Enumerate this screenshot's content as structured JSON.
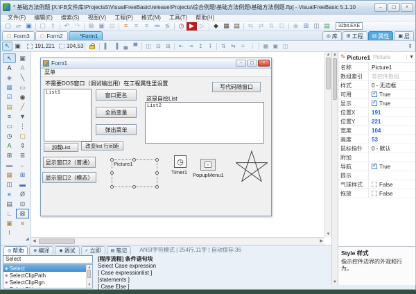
{
  "window": {
    "title": "* 基础方法例题 [X:\\FB文件库\\Projects5\\VisualFreeBasic\\release\\Projects\\综合例题\\基础方法例题\\基础方法例题.ffp] - VisualFreeBasic 5.1.10",
    "minimize": "–",
    "maximize": "▢",
    "close": "×"
  },
  "menu_bar": {
    "items": [
      "文件(F)",
      "编辑(E)",
      "搜索(S)",
      "视图(V)",
      "工程(P)",
      "格式(M)",
      "工具(T)",
      "帮助(H)"
    ]
  },
  "toolbar_main": {
    "build_target": "32bit.EXE",
    "icons": [
      {
        "n": "new-file-icon",
        "g": "▢",
        "c": "#4a7fc4"
      },
      {
        "n": "open-folder-icon",
        "g": "▱",
        "c": "#4a7fc4"
      },
      {
        "n": "save-icon",
        "g": "▣",
        "c": "#4a7fc4"
      },
      {
        "n": "sep",
        "sep": true
      },
      {
        "n": "save-as-icon",
        "g": "▢",
        "c": "#9aa8b8"
      },
      {
        "n": "import-icon",
        "g": "⇪",
        "c": "#9aa8b8"
      },
      {
        "n": "sep",
        "sep": true
      },
      {
        "n": "undo-icon",
        "g": "↶",
        "c": "#7a92b0"
      },
      {
        "n": "redo-icon",
        "g": "↷",
        "c": "#b8c4d0"
      },
      {
        "n": "sep",
        "sep": true
      },
      {
        "n": "delete-code-icon",
        "g": "⊠",
        "c": "#8aa0c0"
      },
      {
        "n": "copy-code-icon",
        "g": "▣",
        "c": "#8aa0c0"
      },
      {
        "n": "paste-code-icon",
        "g": "▤",
        "c": "#c0c8d4"
      },
      {
        "n": "sep",
        "sep": true
      },
      {
        "n": "align-icon",
        "g": "≡",
        "c": "#d08030"
      },
      {
        "n": "indent-icon",
        "g": "≡",
        "c": "#90a4bc"
      },
      {
        "n": "outdent-icon",
        "g": "≡",
        "c": "#90a4bc"
      },
      {
        "n": "bullets-icon",
        "g": "≔",
        "c": "#5080c0"
      },
      {
        "n": "sort-icon",
        "g": "≶",
        "c": "#90a4bc"
      },
      {
        "n": "sep",
        "sep": true
      },
      {
        "n": "compile-icon",
        "g": "◷",
        "c": "#c23030"
      },
      {
        "n": "run-icon",
        "g": "▶",
        "c": "#ffffff",
        "bg": "#b82020"
      },
      {
        "n": "run-alt-icon",
        "g": "▷",
        "c": "#9aa8b8"
      },
      {
        "n": "sep",
        "sep": true
      },
      {
        "n": "build-exe-icon",
        "g": "◆",
        "c": "#46392c"
      },
      {
        "n": "build-image-icon",
        "g": "▦",
        "c": "#54483c"
      },
      {
        "n": "build-media-icon",
        "g": "▤",
        "c": "#54483c"
      },
      {
        "n": "sep",
        "sep": true
      },
      {
        "n": "debug-jump-icon",
        "g": "⇆",
        "c": "#b4bfca"
      },
      {
        "n": "debug-step-icon",
        "g": "⇄",
        "c": "#b4bfca"
      },
      {
        "n": "debug-over-icon",
        "g": "⇅",
        "c": "#b4bfca"
      },
      {
        "n": "breakpoint-icon",
        "g": "⊡",
        "c": "#b4bfca"
      },
      {
        "n": "sep",
        "sep": true
      },
      {
        "n": "stamp-icon",
        "g": "◉",
        "c": "#b4bfca"
      },
      {
        "n": "grid-window-icon",
        "g": "⊞",
        "c": "#4a7fc4"
      },
      {
        "n": "window-icon",
        "g": "◫",
        "c": "#6a7a8a"
      },
      {
        "n": "notes-icon",
        "g": "▤",
        "c": "#3a9a5a"
      }
    ]
  },
  "form_tabs": [
    {
      "label": "Form3",
      "active": false
    },
    {
      "label": "Form2",
      "active": false
    },
    {
      "label": "*Form1",
      "active": true
    }
  ],
  "panel_tabs": [
    {
      "label": "库",
      "ic": "◎",
      "active": false
    },
    {
      "label": "工程",
      "ic": "⊞",
      "active": false
    },
    {
      "label": "属性",
      "ic": "▤",
      "active": true
    },
    {
      "label": "层",
      "ic": "▣",
      "active": false
    }
  ],
  "designer_toolbar": {
    "position": "191,221",
    "size": "104,53",
    "spinner": "⇕",
    "icons": [
      {
        "n": "align-left-icon",
        "g": "▌"
      },
      {
        "n": "align-right-icon",
        "g": "▐"
      },
      {
        "n": "align-bottom-icon",
        "g": "▄"
      },
      {
        "n": "align-top-icon",
        "g": "▀"
      },
      {
        "n": "sep",
        "sep": true
      },
      {
        "n": "center-h-icon",
        "g": "◫"
      },
      {
        "n": "center-v-icon",
        "g": "⊟"
      },
      {
        "n": "center-both-icon",
        "g": "⊞"
      },
      {
        "n": "sep",
        "sep": true
      },
      {
        "n": "space-left-icon",
        "g": "⇤"
      },
      {
        "n": "space-right-icon",
        "g": "⇥"
      },
      {
        "n": "space-up-icon",
        "g": "↥"
      },
      {
        "n": "space-down-icon",
        "g": "↧"
      },
      {
        "n": "sep",
        "sep": true
      },
      {
        "n": "same-height-icon",
        "g": "⇅"
      },
      {
        "n": "same-width-icon",
        "g": "⇆"
      },
      {
        "n": "same-size-icon",
        "g": "≡"
      },
      {
        "n": "distribute-icon",
        "g": "⋮"
      },
      {
        "n": "sep",
        "sep": true
      },
      {
        "n": "to-grid-icon",
        "g": "▦"
      },
      {
        "n": "to-front-icon",
        "g": "▣"
      },
      {
        "n": "to-back-icon",
        "g": "◫"
      }
    ]
  },
  "toolbox": {
    "tools": [
      {
        "n": "pointer-tool",
        "g": "↖",
        "c": "#2a4a6a",
        "sel": true
      },
      {
        "n": "select-group-tool",
        "g": "▣",
        "c": "#5a6a7a"
      },
      {
        "n": "label-tool",
        "g": "A",
        "c": "#222222"
      },
      {
        "n": "link-label-tool",
        "g": "A",
        "c": "#8a9ab0"
      },
      {
        "n": "shape-tool",
        "g": "◈",
        "c": "#7a6ab0"
      },
      {
        "n": "line-tool",
        "g": "╲",
        "c": "#555555"
      },
      {
        "n": "image-tool",
        "g": "▦",
        "c": "#5a8ac0"
      },
      {
        "n": "frame-tool",
        "g": "▭",
        "c": "#777777"
      },
      {
        "n": "checkbox-tool",
        "g": "☑",
        "c": "#3a7ac0"
      },
      {
        "n": "radio-tool",
        "g": "◉",
        "c": "#444444"
      },
      {
        "n": "tab-page-tool",
        "g": "▤",
        "c": "#b08a40"
      },
      {
        "n": "pen-tool",
        "g": "╱",
        "c": "#b06a30"
      },
      {
        "n": "listbox-tool",
        "g": "≡",
        "c": "#505a64"
      },
      {
        "n": "combobox-tool",
        "g": "▼",
        "c": "#505a64"
      },
      {
        "n": "textbox-tool",
        "g": "▭",
        "c": "#3a6ac0"
      },
      {
        "n": "slider-tool",
        "g": "⋮",
        "c": "#505a64"
      },
      {
        "n": "timer-tool",
        "g": "◷",
        "c": "#444444"
      },
      {
        "n": "folder-tool",
        "g": "▢",
        "c": "#b09040"
      },
      {
        "n": "auto-label-tool",
        "g": "A",
        "c": "#2a7a3a"
      },
      {
        "n": "updown-tool",
        "g": "⇕",
        "c": "#44505c"
      },
      {
        "n": "grid-tool",
        "g": "⊞",
        "c": "#505a64"
      },
      {
        "n": "tree-tool",
        "g": "≣",
        "c": "#505a64"
      },
      {
        "n": "separator-tool",
        "g": "▬",
        "c": "#9099a8"
      },
      {
        "n": "arrow-tool",
        "g": "←",
        "c": "#505a64"
      },
      {
        "n": "picturebox-tool",
        "g": "▦",
        "c": "#b08a40"
      },
      {
        "n": "calendar-tool",
        "g": "⊞",
        "c": "#3a6ac0"
      },
      {
        "n": "tabstrip-tool",
        "g": "◫",
        "c": "#505a64"
      },
      {
        "n": "statusbar-tool",
        "g": "▬",
        "c": "#3a6ac0"
      },
      {
        "n": "browser-tool",
        "g": "e",
        "c": "#2a7ad0"
      },
      {
        "n": "orbit-tool",
        "g": "Ø",
        "c": "#505a64"
      },
      {
        "n": "listview-tool",
        "g": "▤",
        "c": "#505a64"
      },
      {
        "n": "optionbox-tool",
        "g": "⊡",
        "c": "#505a64"
      },
      {
        "n": "chart-tool",
        "g": "∟",
        "c": "#505a64"
      },
      {
        "n": "close-box-tool",
        "g": "⊠",
        "c": "#44505c",
        "picked": true
      },
      {
        "n": "image-frame-tool",
        "g": "▣",
        "c": "#b08a40"
      },
      {
        "n": "database-tool",
        "g": "≡",
        "c": "#a08030"
      },
      {
        "n": "warning-tool",
        "g": "!",
        "c": "#c04040"
      },
      {
        "n": "blank-tool",
        "g": "",
        "c": "#000000"
      }
    ]
  },
  "designer": {
    "form": {
      "title": "Form1",
      "minimize": "–",
      "maximize": "▢",
      "close": "×",
      "menu": "菜单",
      "info_label": "不需要DOS窗口（调试输出用）在工程属性里设置",
      "code_button": "写代码随窗口",
      "list1_text": "List1",
      "mid_buttons": [
        {
          "label": "窗口更名"
        },
        {
          "label": "全局变量"
        },
        {
          "label": "弹出菜单"
        }
      ],
      "list2_label": "这是自绘List",
      "list2_text": "List2",
      "load_button": "加载List",
      "spacing_button": "改变list 行间距",
      "show_normal_button": "显示窗口2（普通）",
      "show_modal_button": "显示窗口2（模态）",
      "picture_label": "Picture1",
      "timer_label": "Timer1",
      "popup_label": "PopupMenu1"
    }
  },
  "properties": {
    "header_name": "Picture1",
    "header_type": "Picture",
    "rows": [
      {
        "label": "名称",
        "value": "Picture1"
      },
      {
        "label": "数组索引",
        "value": "非控件数组",
        "cls": "muted"
      },
      {
        "label": "样式",
        "value": "0 - 无边框"
      },
      {
        "label": "可用",
        "value": "True",
        "check": true,
        "checked": true
      },
      {
        "label": "显示",
        "value": "True",
        "check": true,
        "checked": true
      },
      {
        "label": "位置X",
        "value": "191",
        "cls": "num"
      },
      {
        "label": "位置Y",
        "value": "221",
        "cls": "num"
      },
      {
        "label": "宽度",
        "value": "104",
        "cls": "num"
      },
      {
        "label": "高度",
        "value": "53",
        "cls": "num"
      },
      {
        "label": "鼠标指针",
        "value": "0 - 默认"
      },
      {
        "label": "附加",
        "value": ""
      },
      {
        "label": "导航",
        "value": "True",
        "check": true,
        "checked": true
      },
      {
        "label": "提示",
        "value": ""
      },
      {
        "label": "气球样式",
        "value": "False",
        "check": true,
        "checked": false
      },
      {
        "label": "拖放",
        "value": "False",
        "check": true,
        "checked": false
      }
    ],
    "description": {
      "title": "Style 样式",
      "text": "指示控件边界的外观和行为。"
    }
  },
  "bottom": {
    "tabs": [
      {
        "label": "帮助",
        "ic": "◎",
        "active": true
      },
      {
        "label": "编译",
        "ic": "⊕",
        "active": false
      },
      {
        "label": "调试",
        "ic": "◉",
        "active": false
      },
      {
        "label": "立即",
        "ic": "✓",
        "active": false
      },
      {
        "label": "笔记",
        "ic": "▤",
        "active": false
      }
    ],
    "status": "ANSI字符模式 | 254行,11字 | 自动保存:36",
    "search_value": "Select",
    "list_items": [
      {
        "label": "Select",
        "selected": true
      },
      {
        "label": "SelectClipPath",
        "selected": false
      },
      {
        "label": "SelectClipRgn",
        "selected": false
      },
      {
        "label": "SelectObject",
        "selected": false
      }
    ],
    "help_lines": [
      {
        "text": "[程序流程] 条件语句块",
        "bold": true
      },
      {
        "text": "Select Case expression",
        "bold": false
      },
      {
        "text": "[ Case expressionlist ]",
        "bold": false
      },
      {
        "text": "[statements ]",
        "bold": false
      },
      {
        "text": "[ Case Else ]",
        "bold": false
      }
    ]
  }
}
